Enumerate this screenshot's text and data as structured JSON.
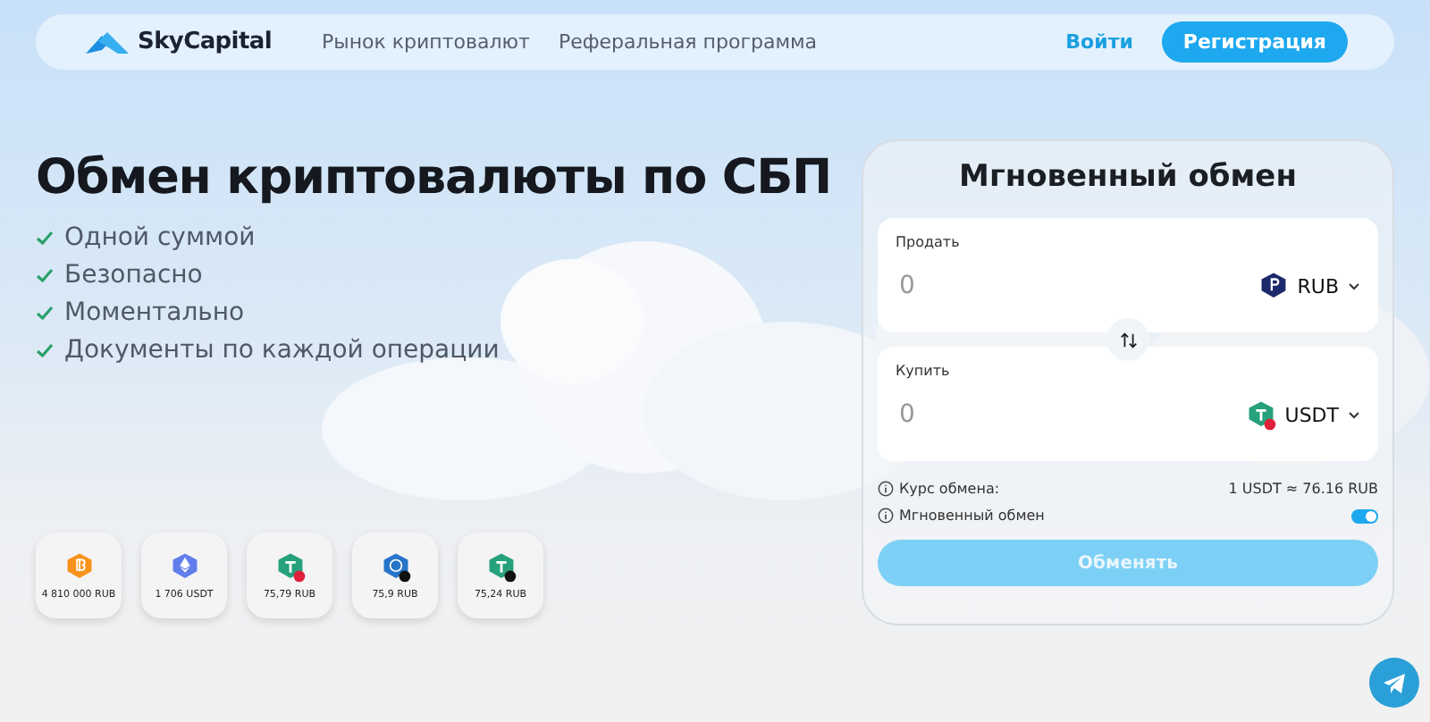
{
  "header": {
    "brand": "SkyCapital",
    "nav": [
      {
        "label": "Рынок криптовалют"
      },
      {
        "label": "Реферальная программа"
      }
    ],
    "login": "Войти",
    "register": "Регистрация"
  },
  "hero": {
    "title": "Обмен криптовалюты по СБП",
    "features": [
      "Одной суммой",
      "Безопасно",
      "Моментально",
      "Документы по каждой операции"
    ]
  },
  "rates": [
    {
      "kind": "btc",
      "color": "#f7931a",
      "amount": "4 810 000 RUB"
    },
    {
      "kind": "eth",
      "color": "#627eea",
      "amount": "1 706 USDT"
    },
    {
      "kind": "usdt",
      "color": "#26a17b",
      "badge": {
        "color": "#e0203a"
      },
      "amount": "75,79 RUB"
    },
    {
      "kind": "usdc",
      "color": "#2775ca",
      "badge": {
        "color": "#111111"
      },
      "amount": "75,9 RUB"
    },
    {
      "kind": "usdt",
      "color": "#26a17b",
      "badge": {
        "color": "#111111"
      },
      "amount": "75,24 RUB"
    }
  ],
  "exchange": {
    "title": "Мгновенный обмен",
    "sell": {
      "label": "Продать",
      "placeholder": "0",
      "currency": "RUB",
      "kind": "rub"
    },
    "buy": {
      "label": "Купить",
      "placeholder": "0",
      "currency": "USDT",
      "kind": "usdt"
    },
    "rate_label": "Курс обмена:",
    "rate_value": "1 USDT ≈ 76.16 RUB",
    "instant_label": "Мгновенный обмен",
    "instant_on": true,
    "submit": {
      "label": "Обменять",
      "disabled": true
    }
  }
}
